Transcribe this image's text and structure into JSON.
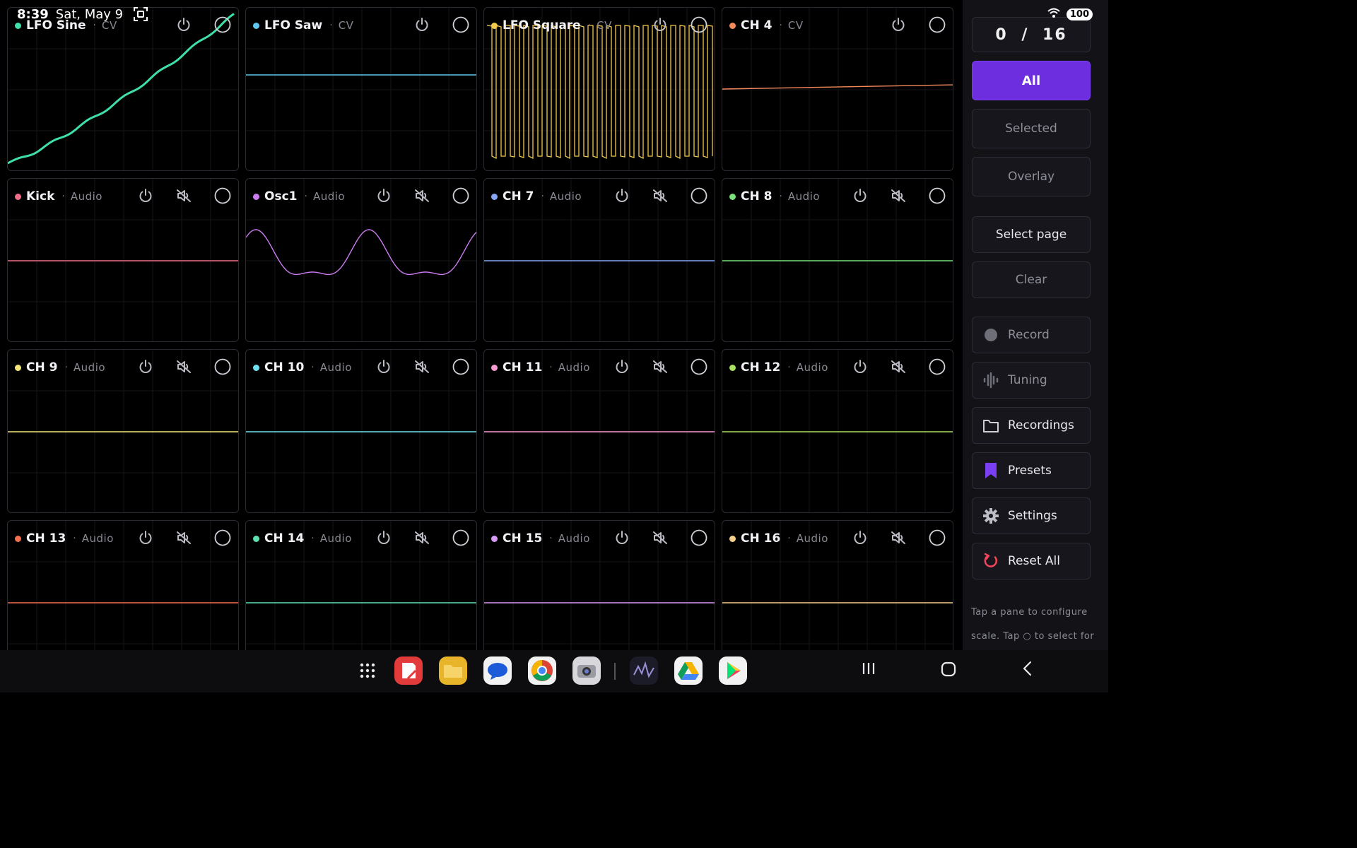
{
  "status_bar": {
    "time": "8:39",
    "date": "Sat, May 9",
    "battery": "100"
  },
  "sidebar": {
    "counter": {
      "current": "0",
      "separator": "/",
      "total": "16"
    },
    "buttons": {
      "all": "All",
      "selected": "Selected",
      "overlay": "Overlay",
      "select_page": "Select page",
      "clear": "Clear",
      "record": "Record",
      "tuning": "Tuning",
      "recordings": "Recordings",
      "presets": "Presets",
      "settings": "Settings",
      "reset_all": "Reset All"
    },
    "hint": "Tap a pane to configure scale. Tap ○ to select for Selected / Overlay."
  },
  "channels": [
    {
      "name": "LFO Sine",
      "type": "CV",
      "color": "#3ee0a8",
      "wave": "sine_ramp"
    },
    {
      "name": "LFO Saw",
      "type": "CV",
      "color": "#5ec8f0",
      "wave": "flat_high"
    },
    {
      "name": "LFO Square",
      "type": "CV",
      "color": "#f2c94c",
      "wave": "square"
    },
    {
      "name": "CH 4",
      "type": "CV",
      "color": "#f4895a",
      "wave": "slight_ramp"
    },
    {
      "name": "Kick",
      "type": "Audio",
      "color": "#f06d8a",
      "wave": "flat"
    },
    {
      "name": "Osc1",
      "type": "Audio",
      "color": "#cc7cf0",
      "wave": "osc"
    },
    {
      "name": "CH 7",
      "type": "Audio",
      "color": "#86a6f5",
      "wave": "flat"
    },
    {
      "name": "CH 8",
      "type": "Audio",
      "color": "#79e07a",
      "wave": "flat"
    },
    {
      "name": "CH 9",
      "type": "Audio",
      "color": "#f5e67a",
      "wave": "flat"
    },
    {
      "name": "CH 10",
      "type": "Audio",
      "color": "#6fe0f0",
      "wave": "flat"
    },
    {
      "name": "CH 11",
      "type": "Audio",
      "color": "#f59ad0",
      "wave": "flat"
    },
    {
      "name": "CH 12",
      "type": "Audio",
      "color": "#a8e060",
      "wave": "flat"
    },
    {
      "name": "CH 13",
      "type": "Audio",
      "color": "#f47050",
      "wave": "flat"
    },
    {
      "name": "CH 14",
      "type": "Audio",
      "color": "#5ee0b0",
      "wave": "flat"
    },
    {
      "name": "CH 15",
      "type": "Audio",
      "color": "#d89af5",
      "wave": "flat"
    },
    {
      "name": "CH 16",
      "type": "Audio",
      "color": "#f5d08a",
      "wave": "flat"
    }
  ],
  "colors": {
    "accent": "#6d2ee0",
    "sidebar_bg": "#121217",
    "pane_border": "#2a2a33"
  },
  "taskbar": {
    "apps": [
      {
        "icon": "app-drawer-icon"
      },
      {
        "icon": "notes-app-icon",
        "color": "#e23b3b"
      },
      {
        "icon": "files-app-icon",
        "color": "#e8b52a"
      },
      {
        "icon": "messages-app-icon",
        "color": "#f2f2f2"
      },
      {
        "icon": "chrome-app-icon",
        "color": "#f2f2f2"
      },
      {
        "icon": "camera-app-icon",
        "color": "#d8d8dc"
      },
      {
        "icon": "scope-app-icon",
        "color": "#1c1c28"
      },
      {
        "icon": "drive-app-icon",
        "color": "#f2f2f2"
      },
      {
        "icon": "play-store-app-icon",
        "color": "#f2f2f2"
      }
    ],
    "nav": [
      "recents-icon",
      "home-icon",
      "back-icon"
    ]
  }
}
